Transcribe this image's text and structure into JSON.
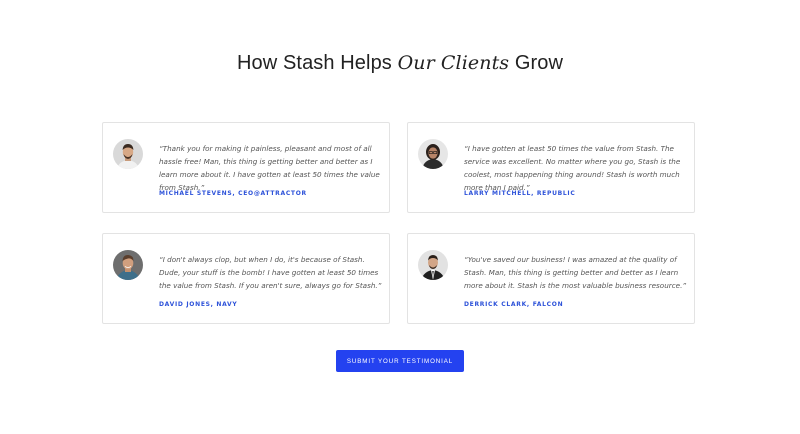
{
  "heading": {
    "prefix": "How Stash Helps ",
    "emphasis": "Our Clients",
    "suffix": " Grow"
  },
  "testimonials": [
    {
      "quote": "“Thank you for making it painless, pleasant and most of all hassle free! Man, this thing is getting better and better as I learn more about it. I have gotten at least 50 times the value from Stash.”",
      "author": "MICHAEL STEVENS, CEO@ATTRACTOR"
    },
    {
      "quote": "“I have gotten at least 50 times the value from Stash. The service was excellent. No matter where you go, Stash is the coolest, most happening thing around! Stash is worth much more than I paid.”",
      "author": "LARRY MITCHELL, REPUBLIC"
    },
    {
      "quote": "“I don't always clop, but when I do, it's because of Stash. Dude, your stuff is the bomb! I have gotten at least 50 times the value from Stash. If you aren't sure, always go for Stash.”",
      "author": "DAVID JONES, NAVY"
    },
    {
      "quote": "“You've saved our business! I was amazed at the quality of Stash. Man, this thing is getting better and better as I learn more about it. Stash is the most valuable business resource.”",
      "author": "DERRICK CLARK, FALCON"
    }
  ],
  "submit_label": "SUBMIT YOUR TESTIMONIAL",
  "colors": {
    "accent": "#2442f0",
    "author": "#2d52d9",
    "border": "#e3e3e3",
    "text": "#555555",
    "heading": "#222222"
  }
}
